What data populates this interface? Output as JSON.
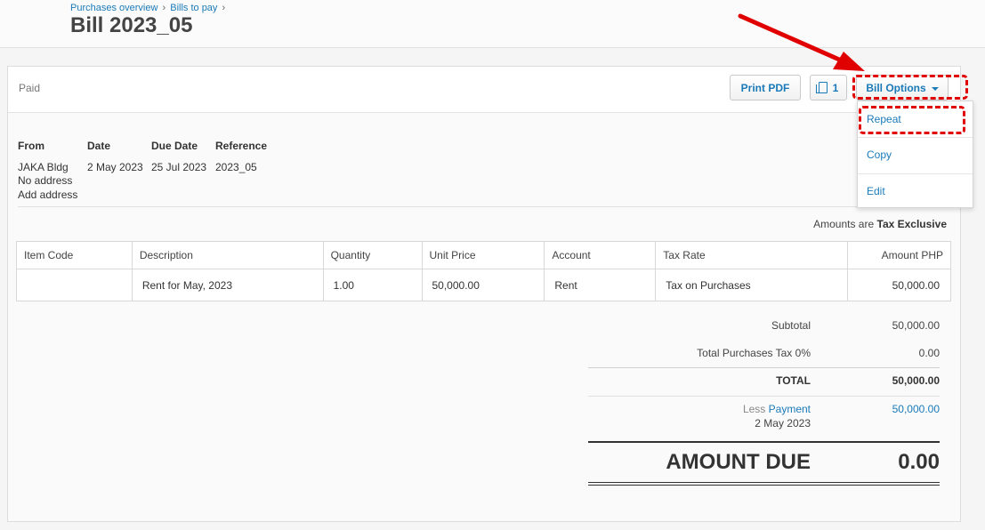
{
  "breadcrumb": {
    "item1": "Purchases overview",
    "item2": "Bills to pay",
    "separator": "›"
  },
  "page": {
    "title": "Bill 2023_05"
  },
  "status": "Paid",
  "toolbar": {
    "print_label": "Print PDF",
    "files_count": "1",
    "options_label": "Bill Options"
  },
  "dropdown": {
    "items": [
      "Repeat",
      "Copy",
      "Edit"
    ]
  },
  "details": {
    "from_label": "From",
    "date_label": "Date",
    "due_label": "Due Date",
    "ref_label": "Reference",
    "from_name": "JAKA Bldg",
    "no_address": "No address",
    "add_address": "Add address",
    "date": "2 May 2023",
    "due_date": "25 Jul 2023",
    "reference": "2023_05"
  },
  "amounts_note": {
    "prefix": "Amounts are",
    "mode": "Tax Exclusive"
  },
  "table": {
    "headers": [
      "Item Code",
      "Description",
      "Quantity",
      "Unit Price",
      "Account",
      "Tax Rate",
      "Amount PHP"
    ],
    "rows": [
      [
        "",
        "Rent for May, 2023",
        "1.00",
        "50,000.00",
        "Rent",
        "Tax on Purchases",
        "50,000.00"
      ]
    ]
  },
  "totals": {
    "subtotal_label": "Subtotal",
    "subtotal": "50,000.00",
    "tax_label": "Total Purchases Tax 0%",
    "tax": "0.00",
    "total_label": "TOTAL",
    "total": "50,000.00",
    "less_label": "Less",
    "payment_label": "Payment",
    "payment_date": "2 May 2023",
    "payment": "50,000.00",
    "amount_due_label": "AMOUNT DUE",
    "amount_due": "0.00"
  },
  "colors": {
    "link": "#1a7ab8",
    "highlight": "#e00000"
  }
}
